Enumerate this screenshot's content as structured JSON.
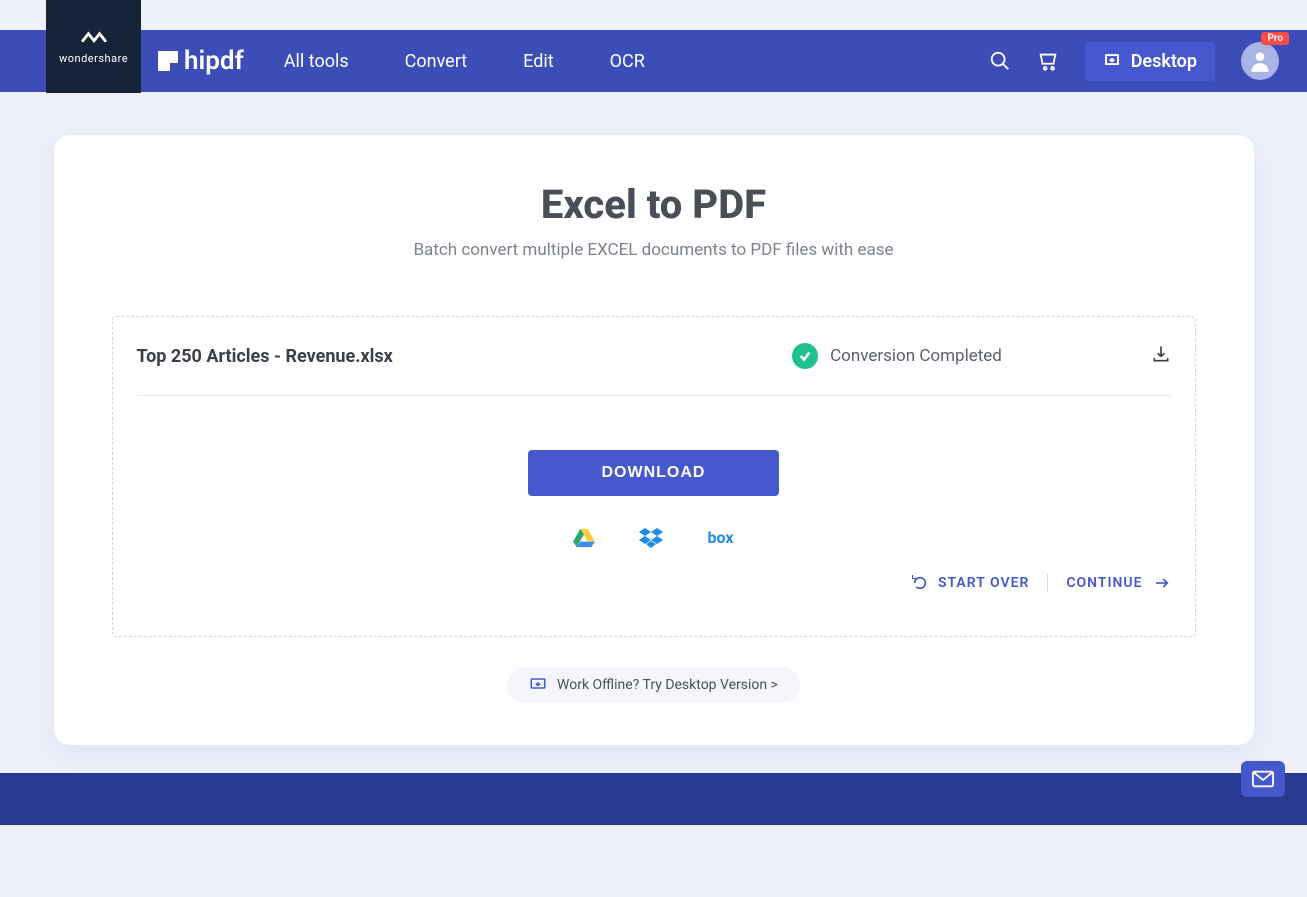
{
  "brand": {
    "wondershare": "wondershare",
    "product": "hipdf"
  },
  "nav": {
    "items": [
      "All tools",
      "Convert",
      "Edit",
      "OCR"
    ],
    "desktop_label": "Desktop",
    "pro_badge": "Pro"
  },
  "page": {
    "title": "Excel to PDF",
    "subtitle": "Batch convert multiple EXCEL documents to PDF files with ease"
  },
  "file": {
    "name": "Top 250 Articles - Revenue.xlsx",
    "status": "Conversion Completed"
  },
  "actions": {
    "download": "DOWNLOAD",
    "start_over": "START OVER",
    "continue": "CONTINUE",
    "offline": "Work Offline? Try Desktop Version >"
  },
  "cloud": {
    "gdrive": "Google Drive",
    "dropbox": "Dropbox",
    "box": "box"
  },
  "colors": {
    "primary": "#4558ce",
    "navbg": "#3c4db7",
    "success": "#1fc18e",
    "pagebg": "#eef0fa"
  }
}
